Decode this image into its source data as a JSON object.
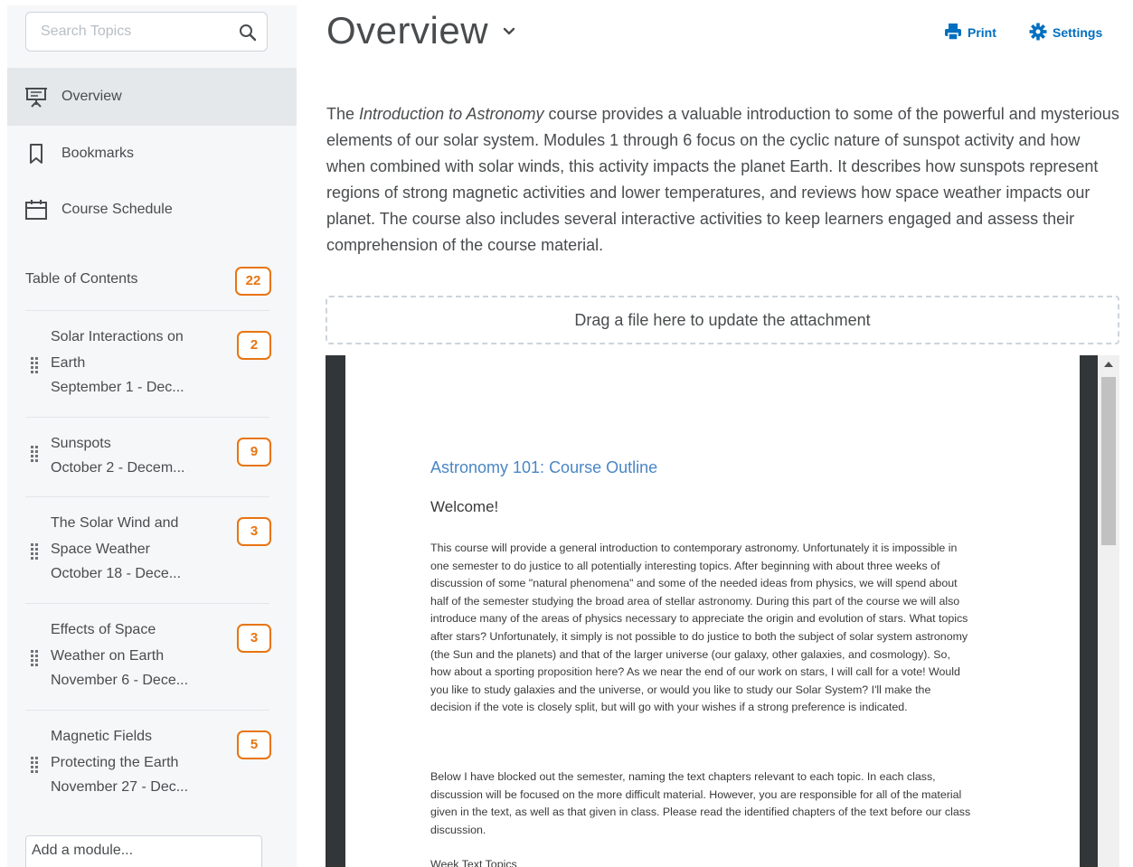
{
  "sidebar": {
    "search_placeholder": "Search Topics",
    "nav": [
      {
        "label": "Overview",
        "icon": "presentation-icon",
        "active": true
      },
      {
        "label": "Bookmarks",
        "icon": "bookmark-icon",
        "active": false
      },
      {
        "label": "Course Schedule",
        "icon": "calendar-icon",
        "active": false
      }
    ],
    "toc_label": "Table of Contents",
    "toc_count": "22",
    "modules": [
      {
        "line1": "Solar Interactions on",
        "line2": "Earth",
        "dates": "September 1 - Dec...",
        "count": "2"
      },
      {
        "line1": "Sunspots",
        "line2": "",
        "dates": "October 2 - Decem...",
        "count": "9"
      },
      {
        "line1": "The Solar Wind and",
        "line2": "Space Weather",
        "dates": "October 18 - Dece...",
        "count": "3"
      },
      {
        "line1": "Effects of Space",
        "line2": "Weather on Earth",
        "dates": "November 6 - Dece...",
        "count": "3"
      },
      {
        "line1": "Magnetic Fields",
        "line2": "Protecting the Earth",
        "dates": "November 27 - Dec...",
        "count": "5"
      }
    ],
    "add_module_label": "Add a module..."
  },
  "header": {
    "title": "Overview",
    "print_label": "Print",
    "settings_label": "Settings"
  },
  "description": {
    "part1": "The ",
    "italic": "Introduction to Astronomy",
    "part2": " course provides a valuable introduction to some of the powerful and mysterious elements of our solar system. Modules 1 through 6 focus on the cyclic nature of sunspot activity and how when combined with solar winds, this activity impacts the planet Earth. It describes how sunspots represent regions of strong magnetic activities and lower temperatures, and reviews how space weather impacts our planet. The course also includes several interactive activities to keep learners engaged and assess their comprehension of the course material."
  },
  "dropzone": {
    "label": "Drag a file here to update the attachment"
  },
  "document": {
    "title": "Astronomy 101: Course Outline",
    "welcome": "Welcome!",
    "para1": "This course will provide a general introduction to contemporary astronomy. Unfortunately it is impossible in one semester to do justice to all potentially interesting topics. After beginning with about three weeks of discussion of some \"natural phenomena\" and some of the needed ideas from physics, we will spend about half of the semester studying the broad area of stellar astronomy. During this part of the course we will also introduce many of the areas of physics necessary to appreciate the origin and evolution of stars. What topics after stars? Unfortunately, it simply is not possible to do justice to both the subject of solar system astronomy (the Sun and the planets) and that of the larger universe (our galaxy, other galaxies, and cosmology). So, how about a sporting proposition here? As we near the end of our work on stars, I will call for a vote! Would you like to study galaxies and the universe, or would you like to study our Solar System? I'll make the decision if the vote is closely split, but will go with your wishes if a strong preference is indicated.",
    "para2": "Below I have blocked out the semester, naming the text chapters relevant to each topic. In each class, discussion will be focused on the more difficult material. However, you are responsible for all of the material given in the text, as well as that given in class. Please read the identified chapters of the text before our class discussion.",
    "table_header": "Week Text Topics"
  },
  "colors": {
    "accent": "#006fbf",
    "badge": "#e87511",
    "doc_title": "#4a86c5"
  }
}
